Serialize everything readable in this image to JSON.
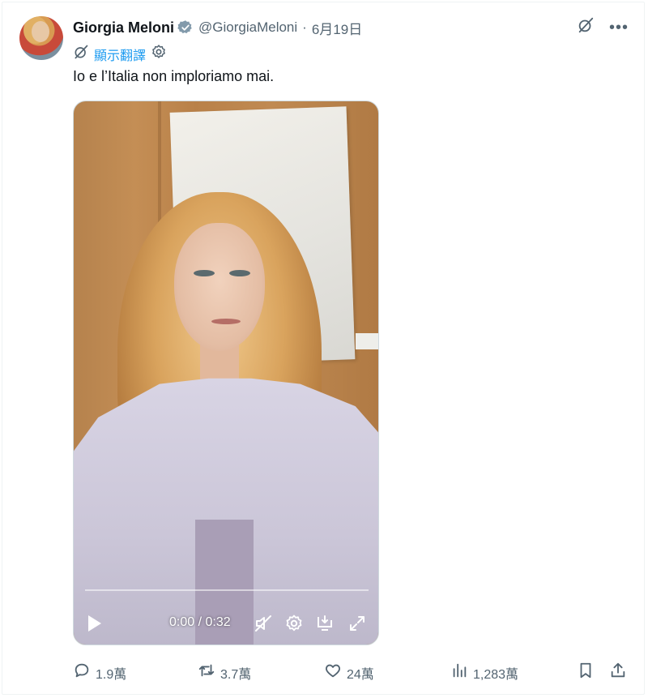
{
  "tweet": {
    "author": {
      "display_name": "Giorgia Meloni",
      "handle": "@GiorgiaMeloni",
      "verified": true
    },
    "separator": "·",
    "date": "6月19日",
    "translate_label": "顯示翻譯",
    "text": "Io e l’Italia non imploriamo mai."
  },
  "video": {
    "time_display": "0:00 / 0:32",
    "progress": 0
  },
  "actions": {
    "replies": "1.9萬",
    "retweets": "3.7萬",
    "likes": "24萬",
    "views": "1,283萬"
  },
  "icons": {
    "top_right": [
      "grok-icon",
      "more-icon"
    ],
    "translate": [
      "translate-icon",
      "settings-gear-icon"
    ],
    "video_controls": [
      "play-icon",
      "mute-icon",
      "settings-icon",
      "pip-icon",
      "fullscreen-icon"
    ],
    "actions": [
      "reply-icon",
      "retweet-icon",
      "like-icon",
      "views-icon",
      "bookmark-icon",
      "share-icon"
    ]
  },
  "colors": {
    "text": "#0f1419",
    "secondary": "#536471",
    "accent": "#1d9bf0",
    "verified": "#829aab"
  }
}
